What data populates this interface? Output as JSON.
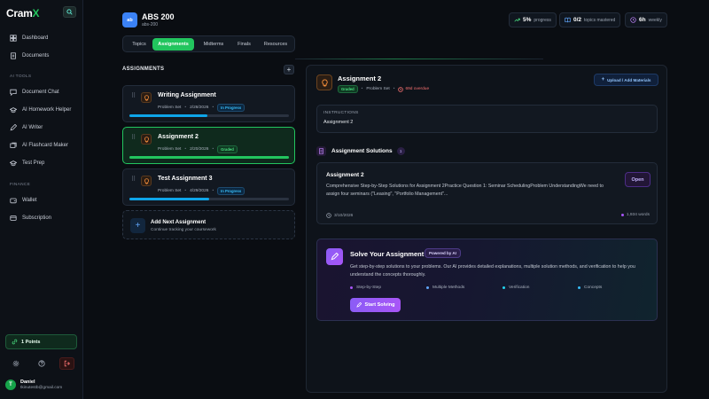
{
  "app": {
    "logo_main": "Cram",
    "logo_accent": "X"
  },
  "sidebar": {
    "items": [
      {
        "label": "Dashboard",
        "icon": "dashboard-icon"
      },
      {
        "label": "Documents",
        "icon": "document-icon"
      }
    ],
    "ai_tools_section": "AI TOOLS",
    "ai_tools": [
      {
        "label": "Document Chat",
        "icon": "chat-icon"
      },
      {
        "label": "AI Homework Helper",
        "icon": "graduation-cap-icon"
      },
      {
        "label": "AI Writer",
        "icon": "pen-icon"
      },
      {
        "label": "AI Flashcard Maker",
        "icon": "flashcard-icon"
      },
      {
        "label": "Test Prep",
        "icon": "graduation-cap-icon"
      }
    ],
    "finance_section": "FINANCE",
    "finance": [
      {
        "label": "Wallet",
        "icon": "wallet-icon"
      },
      {
        "label": "Subscription",
        "icon": "card-icon"
      }
    ],
    "points": "1 Points",
    "user": {
      "initial": "T",
      "name": "Daniel",
      "email": "tkinutestb@gmail.com"
    }
  },
  "course": {
    "badge": "ab",
    "title": "ABS 200",
    "subtitle": "abs-200"
  },
  "stats": {
    "progress_value": "5%",
    "progress_label": "progress",
    "mastered_value": "0/2",
    "mastered_label": "topics mastered",
    "weekly_value": "6h",
    "weekly_label": "weekly"
  },
  "tabs": [
    "Topics",
    "Assignments",
    "Midterms",
    "Finals",
    "Resources"
  ],
  "assignments": {
    "heading": "ASSIGNMENTS",
    "items": [
      {
        "name": "Writing Assignment",
        "type": "Problem Set",
        "date": "2/28/2026",
        "status": "In Progress",
        "progress": 0.49
      },
      {
        "name": "Assignment 2",
        "type": "Problem Set",
        "date": "2/20/2026",
        "status": "Graded",
        "progress": 1.0
      },
      {
        "name": "Test Assignment 3",
        "type": "Problem Set",
        "date": "4/29/2026",
        "status": "In Progress",
        "progress": 0.5
      }
    ],
    "add_title": "Add Next Assignment",
    "add_subtitle": "Continue tracking your coursework"
  },
  "detail": {
    "title": "Assignment 2",
    "status": "Graded",
    "type": "Problem Set",
    "overdue": "69d overdue",
    "upload_label": "Upload / Add Materials",
    "instructions_label": "INSTRUCTIONS",
    "instructions_value": "Assignment 2",
    "solutions_heading": "Assignment Solutions",
    "solutions_count": "1",
    "solution": {
      "title": "Assignment 2",
      "description": "Comprehensive Step-by-Step Solutions for Assignment 2Practice Question 1: Seminar SchedulingProblem UnderstandingWe need to assign four seminars (\"Leasing\", \"Portfolio Management\"...",
      "open_label": "Open",
      "date": "3/10/2026",
      "words": "1,934 words"
    },
    "ai": {
      "title": "Solve Your Assignment",
      "badge": "Powered by AI",
      "description": "Get step-by-step solutions to your problems. Our AI provides detailed explanations, multiple solution methods, and verification to help you understand the concepts thoroughly.",
      "features": [
        "Step-by-Step",
        "Multiple Methods",
        "Verification",
        "Concepts"
      ],
      "button": "Start Solving"
    }
  },
  "colors": {
    "accent": "#22c55e",
    "blue": "#38bdf8",
    "purple": "#a855f7"
  }
}
